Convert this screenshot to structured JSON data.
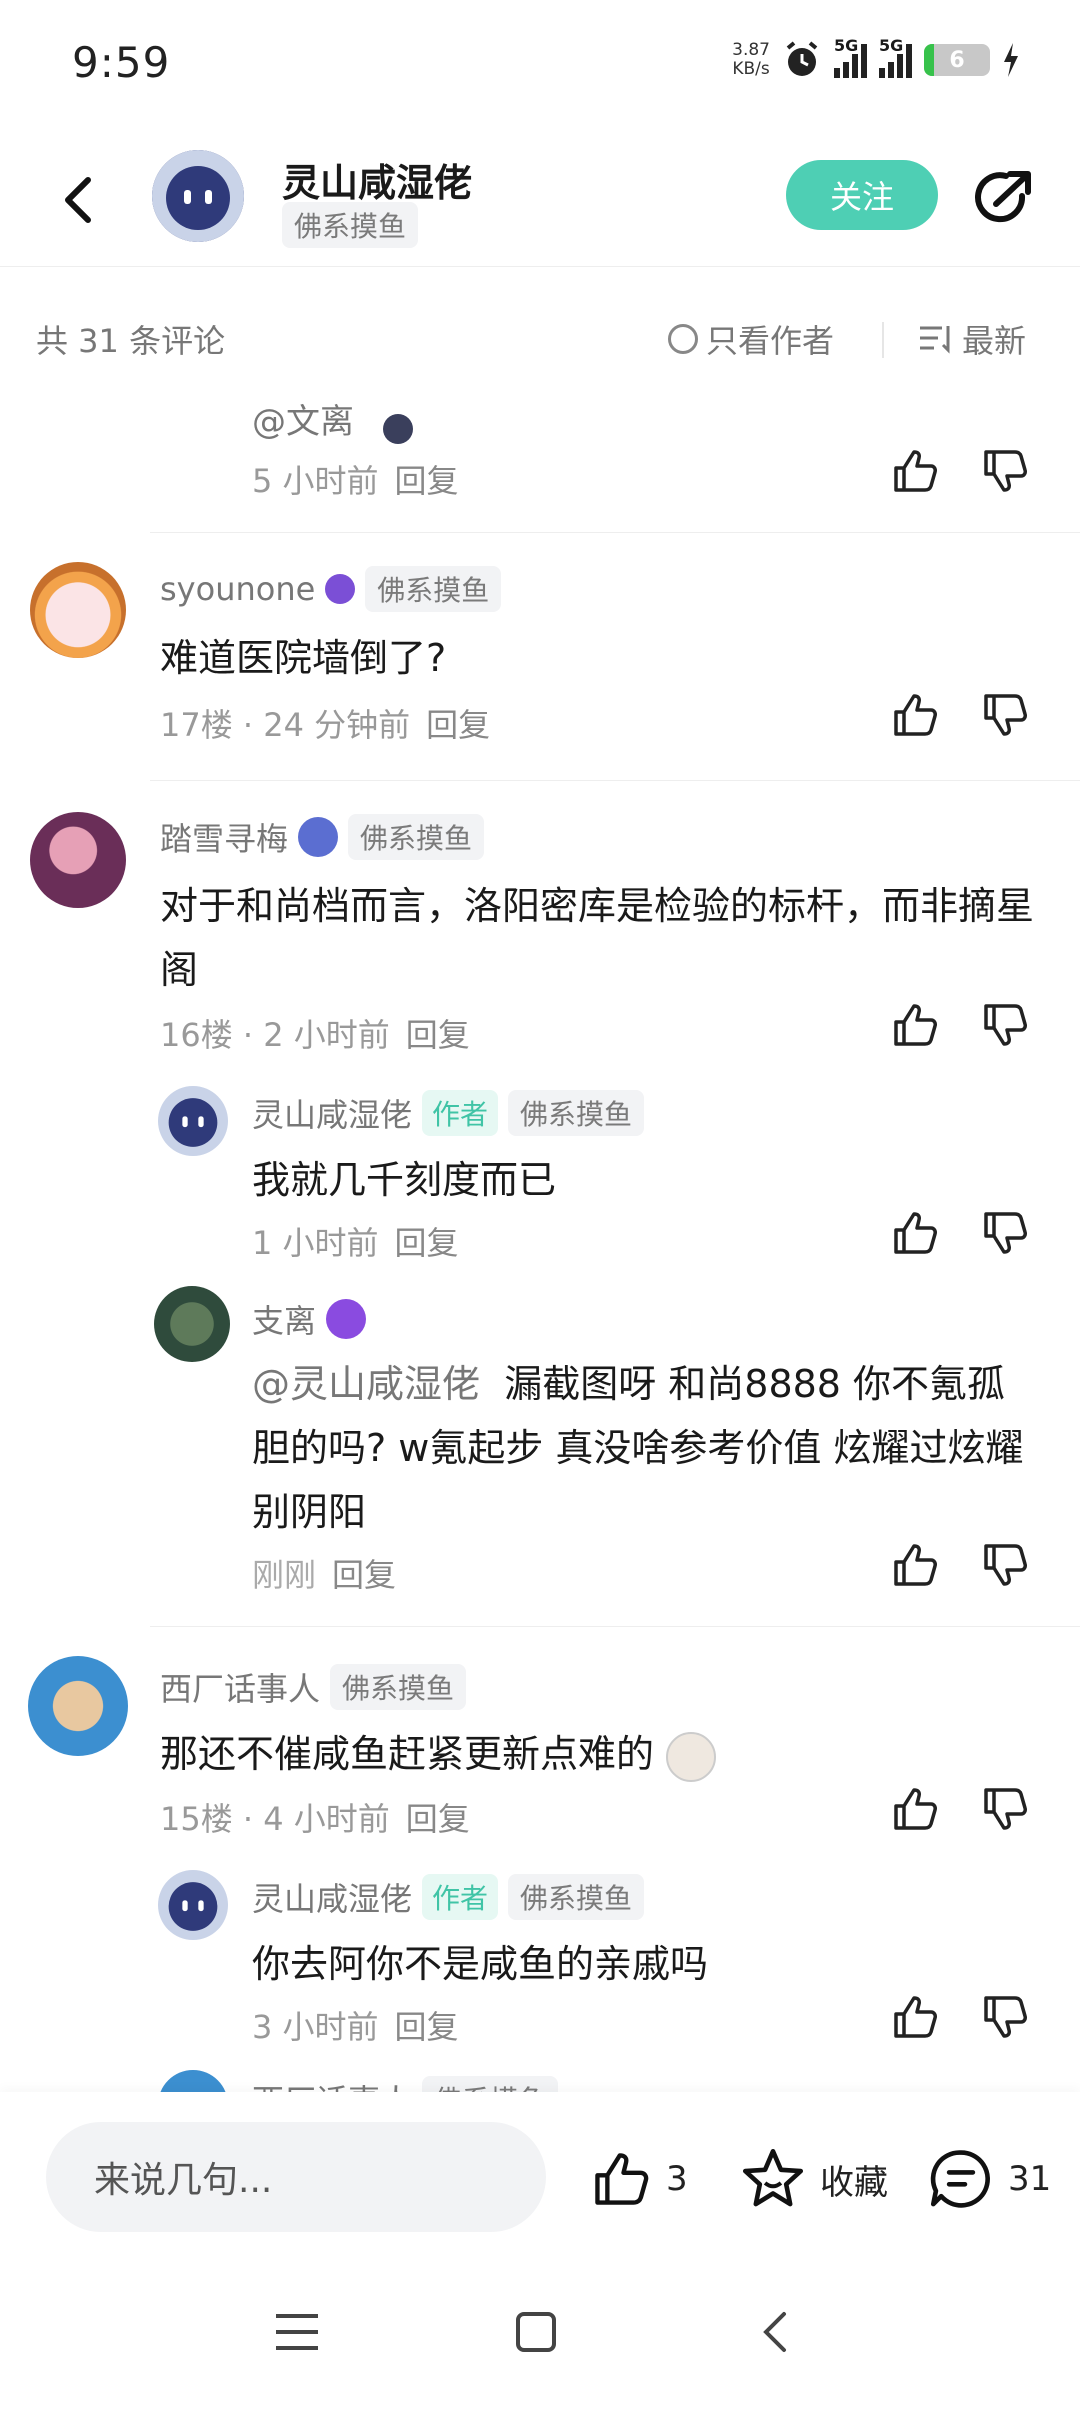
{
  "status": {
    "time": "9:59",
    "speed_value": "3.87",
    "speed_unit": "KB/s",
    "sim1": "5G",
    "sim2": "5G",
    "battery": "6"
  },
  "header": {
    "title": "灵山咸湿佬",
    "tag": "佛系摸鱼",
    "follow": "关注"
  },
  "bar": {
    "count": "共 31 条评论",
    "only_author": "只看作者",
    "sort": "最新"
  },
  "comments": {
    "c0": {
      "mention": "@文离",
      "time": "5 小时前",
      "reply": "回复"
    },
    "c1": {
      "user": "syounone",
      "tag": "佛系摸鱼",
      "text": "难道医院墙倒了?",
      "floor": "17楼",
      "time": "24 分钟前",
      "reply": "回复"
    },
    "c2": {
      "user": "踏雪寻梅",
      "tag": "佛系摸鱼",
      "text": "对于和尚档而言，洛阳密库是检验的标杆，而非摘星阁",
      "floor": "16楼",
      "time": "2 小时前",
      "reply": "回复"
    },
    "c2r1": {
      "user": "灵山咸湿佬",
      "author": "作者",
      "tag": "佛系摸鱼",
      "text": "我就几千刻度而已",
      "time": "1 小时前",
      "reply": "回复"
    },
    "c2r2": {
      "user": "支离",
      "mention": "@灵山咸湿佬",
      "text": "漏截图呀 和尚8888 你不氪孤胆的吗? w氪起步 真没啥参考价值 炫耀过炫耀 别阴阳",
      "time": "刚刚",
      "reply": "回复"
    },
    "c3": {
      "user": "西厂话事人",
      "tag": "佛系摸鱼",
      "text": "那还不催咸鱼赶紧更新点难的",
      "floor": "15楼",
      "time": "4 小时前",
      "reply": "回复"
    },
    "c3r1": {
      "user": "灵山咸湿佬",
      "author": "作者",
      "tag": "佛系摸鱼",
      "text": "你去阿你不是咸鱼的亲戚吗",
      "time": "3 小时前",
      "reply": "回复"
    },
    "c3r2": {
      "user": "西厂话事人",
      "tag": "佛系摸鱼"
    }
  },
  "bottom": {
    "placeholder": "来说几句...",
    "likes": "3",
    "collect": "收藏",
    "comments": "31"
  },
  "colors": {
    "accent": "#4ecfb4",
    "author_tag": "#40c4a6",
    "muted": "#999999"
  }
}
